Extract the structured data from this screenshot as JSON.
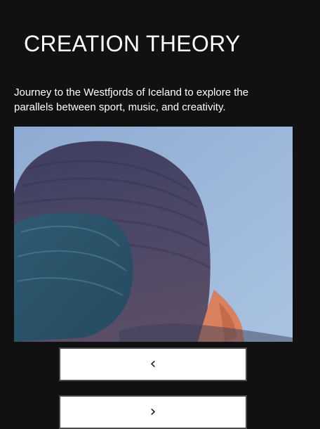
{
  "page": {
    "title": "CREATION THEORY",
    "description": "Journey to the Westfjords of Iceland to explore the parallels between sport, music, and creativity."
  },
  "media": {
    "alt": "Close-up of a person wearing a knit beanie against a pale blue sky"
  },
  "carousel": {
    "prev_symbol": "‹",
    "next_symbol": "›"
  },
  "colors": {
    "background": "#111111",
    "text": "#ffffff",
    "button_bg": "#ffffff",
    "button_border": "#4a4a4a",
    "sky": "#9ab4d6"
  }
}
